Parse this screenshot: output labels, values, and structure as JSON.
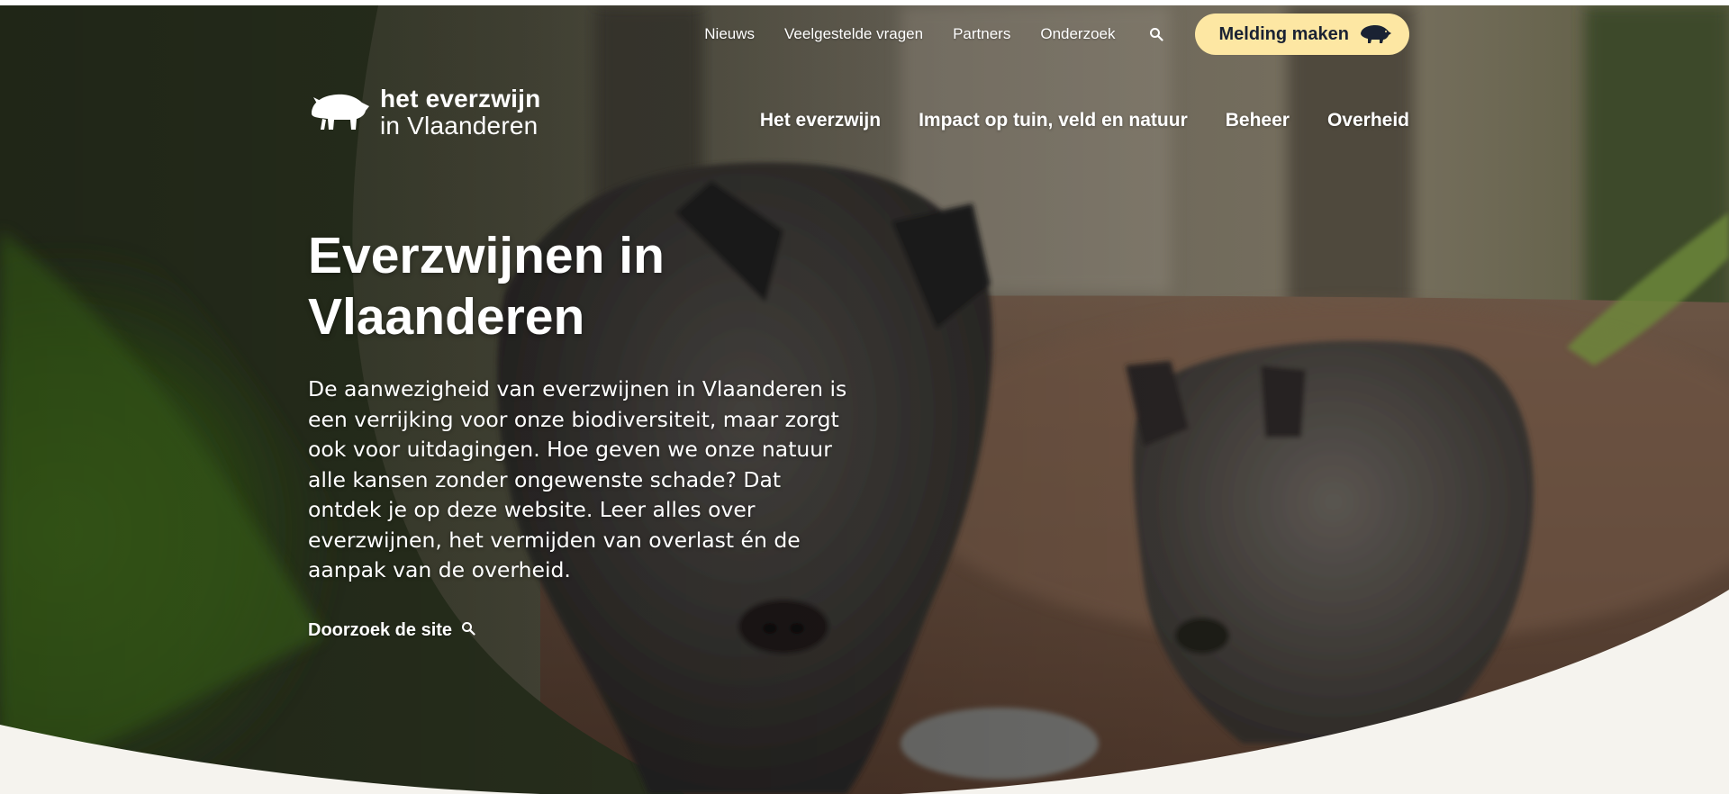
{
  "utility_nav": {
    "items": [
      {
        "label": "Nieuws"
      },
      {
        "label": "Veelgestelde vragen"
      },
      {
        "label": "Partners"
      },
      {
        "label": "Onderzoek"
      }
    ],
    "search_icon": "search-icon",
    "report_button": {
      "label": "Melding maken",
      "icon": "boar-icon",
      "color": "#fde7a3"
    }
  },
  "logo": {
    "line1": "het everzwijn",
    "line2": "in Vlaanderen",
    "icon": "boar-logo-icon"
  },
  "main_nav": {
    "items": [
      {
        "label": "Het everzwijn"
      },
      {
        "label": "Impact op tuin, veld en natuur"
      },
      {
        "label": "Beheer"
      },
      {
        "label": "Overheid"
      }
    ]
  },
  "hero": {
    "title": "Everzwijnen in Vlaanderen",
    "text": "De aanwezigheid van everzwijnen in Vlaanderen is een verrijking voor onze biodiversiteit, maar zorgt ook voor uitdagingen. Hoe geven we onze natuur alle kansen zonder ongewenste schade? Dat ontdek je op deze website. Leer alles over everzwijnen, het vermijden van overlast én de aanpak van de overheid.",
    "search_link": {
      "label": "Doorzoek de site",
      "icon": "search-icon"
    }
  },
  "colors": {
    "accent": "#fde7a3",
    "background": "#f5f3ee",
    "dark_text": "#1a2233"
  }
}
